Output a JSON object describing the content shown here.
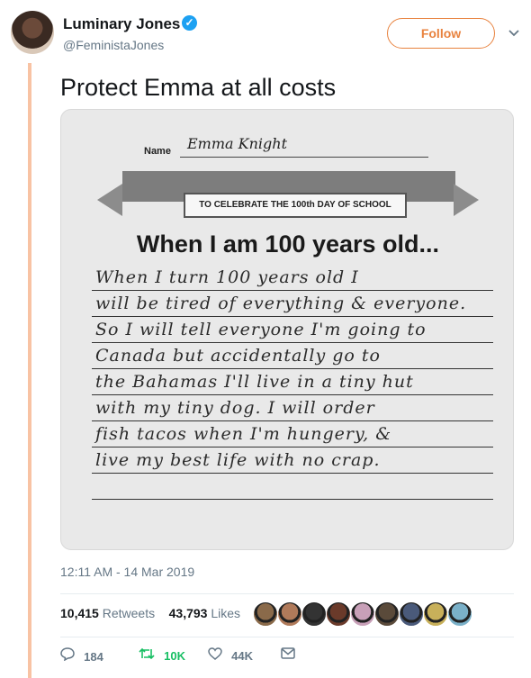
{
  "user": {
    "display_name": "Luminary Jones",
    "handle": "@FeministaJones",
    "follow_label": "Follow",
    "verified_glyph": "✓"
  },
  "tweet": {
    "text": "Protect Emma at all costs",
    "timestamp": "12:11 AM - 14 Mar 2019"
  },
  "photo": {
    "name_label": "Name",
    "name_value": "Emma Knight",
    "banner": "TO CELEBRATE THE 100th DAY OF SCHOOL",
    "headline": "When I am 100 years old...",
    "lines": [
      "When I turn 100 years old I",
      "will be tired of everything & everyone.",
      "So I will tell everyone I'm going to",
      "Canada but accidentally go to",
      "the Bahamas I'll live in a tiny hut",
      "with my tiny dog. I will order",
      "fish tacos when I'm hungery, &",
      "live my best life with no crap.",
      ""
    ]
  },
  "stats": {
    "retweets_count": "10,415",
    "retweets_label": "Retweets",
    "likes_count": "43,793",
    "likes_label": "Likes",
    "liker_colors": [
      "#8a6a4a",
      "#b07a5a",
      "#333333",
      "#6a3a2a",
      "#c8a0b8",
      "#5a4a3a",
      "#4a5a7a",
      "#c8b05a",
      "#7ab0c8"
    ]
  },
  "actions": {
    "reply_count": "184",
    "retweet_count": "10K",
    "like_count": "44K",
    "reply_icon": "reply-icon",
    "retweet_icon": "retweet-icon",
    "like_icon": "heart-icon",
    "dm_icon": "envelope-icon"
  },
  "colors": {
    "accent": "#e8823e",
    "thread_line": "#f8c3a4",
    "verified": "#1da1f2",
    "retweet_green": "#17bf63"
  }
}
